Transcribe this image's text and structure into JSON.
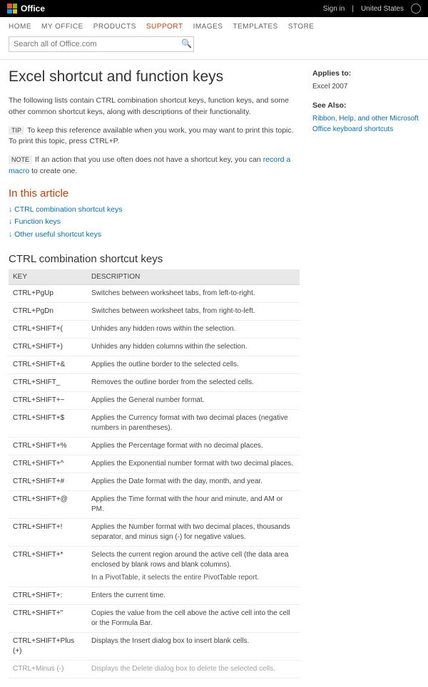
{
  "brand": "Office",
  "top_right": {
    "signin": "Sign in",
    "region": "United States"
  },
  "nav": [
    "HOME",
    "MY OFFICE",
    "PRODUCTS",
    "SUPPORT",
    "IMAGES",
    "TEMPLATES",
    "STORE"
  ],
  "nav_active_index": 3,
  "search": {
    "placeholder": "Search all of Office.com"
  },
  "page": {
    "title": "Excel shortcut and function keys",
    "intro": "The following lists contain CTRL combination shortcut keys, function keys, and some other common shortcut keys, along with descriptions of their functionality.",
    "tip_tag": "TIP",
    "tip_text": "To keep this reference available when you work, you may want to print this topic. To print this topic, press CTRL+P.",
    "note_tag": "NOTE",
    "note_prefix": "If an action that you use often does not have a shortcut key, you can ",
    "note_link": "record a macro",
    "note_suffix": " to create one."
  },
  "in_this_article": {
    "heading": "In this article",
    "links": [
      "CTRL combination shortcut keys",
      "Function keys",
      "Other useful shortcut keys"
    ]
  },
  "table_section_title": "CTRL combination shortcut keys",
  "table_headers": {
    "key": "KEY",
    "desc": "DESCRIPTION"
  },
  "shortcuts": [
    {
      "key": "CTRL+PgUp",
      "desc": "Switches between worksheet tabs, from left-to-right."
    },
    {
      "key": "CTRL+PgDn",
      "desc": "Switches between worksheet tabs, from right-to-left."
    },
    {
      "key": "CTRL+SHIFT+(",
      "desc": "Unhides any hidden rows within the selection."
    },
    {
      "key": "CTRL+SHIFT+)",
      "desc": "Unhides any hidden columns within the selection."
    },
    {
      "key": "CTRL+SHIFT+&",
      "desc": "Applies the outline border to the selected cells."
    },
    {
      "key": "CTRL+SHIFT_",
      "desc": "Removes the outline border from the selected cells."
    },
    {
      "key": "CTRL+SHIFT+~",
      "desc": "Applies the General number format."
    },
    {
      "key": "CTRL+SHIFT+$",
      "desc": "Applies the Currency format with two decimal places (negative numbers in parentheses)."
    },
    {
      "key": "CTRL+SHIFT+%",
      "desc": "Applies the Percentage format with no decimal places."
    },
    {
      "key": "CTRL+SHIFT+^",
      "desc": "Applies the Exponential number format with two decimal places."
    },
    {
      "key": "CTRL+SHIFT+#",
      "desc": "Applies the Date format with the day, month, and year."
    },
    {
      "key": "CTRL+SHIFT+@",
      "desc": "Applies the Time format with the hour and minute, and AM or PM."
    },
    {
      "key": "CTRL+SHIFT+!",
      "desc": "Applies the Number format with two decimal places, thousands separator, and minus sign (-) for negative values."
    },
    {
      "key": "CTRL+SHIFT+*",
      "desc": "Selects the current region around the active cell (the data area enclosed by blank rows and blank columns).",
      "sub": "In a PivotTable, it selects the entire PivotTable report."
    },
    {
      "key": "CTRL+SHIFT+:",
      "desc": "Enters the current time."
    },
    {
      "key": "CTRL+SHIFT+\"",
      "desc": "Copies the value from the cell above the active cell into the cell or the Formula Bar."
    },
    {
      "key": "CTRL+SHIFT+Plus (+)",
      "desc": "Displays the Insert dialog box to insert blank cells."
    },
    {
      "key": "CTRL+Minus (-)",
      "desc": "Displays the Delete dialog box to delete the selected cells."
    }
  ],
  "aside": {
    "applies_label": "Applies to:",
    "applies_value": "Excel 2007",
    "see_also_label": "See Also:",
    "see_also_link": "Ribbon, Help, and other Microsoft Office keyboard shortcuts"
  }
}
